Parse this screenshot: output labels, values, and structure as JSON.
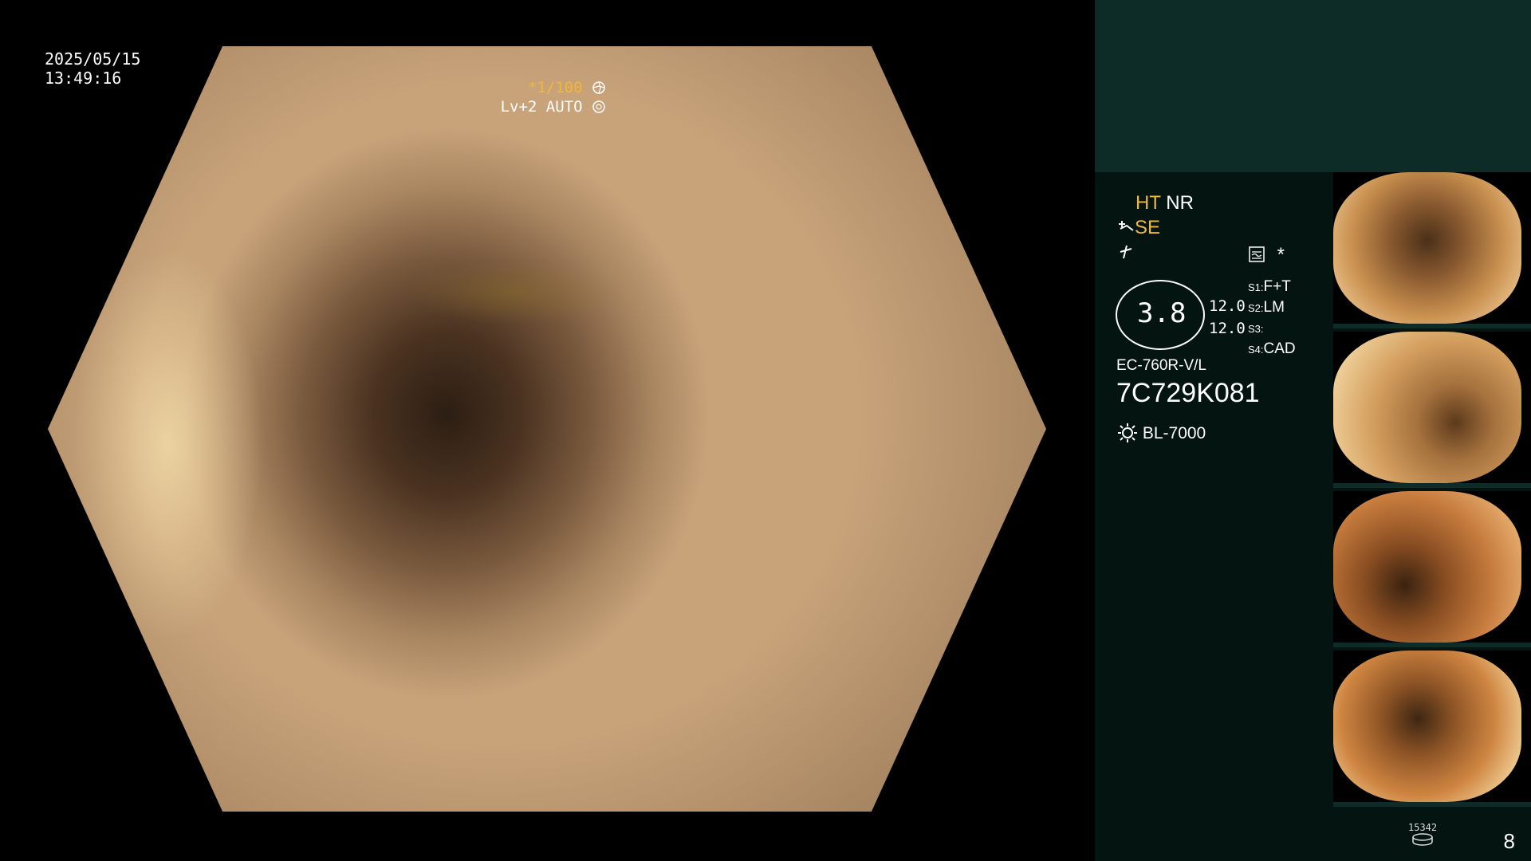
{
  "header": {
    "date": "2025/05/15",
    "time": "13:49:16",
    "shutter_prefix": "*",
    "shutter": "1/100",
    "level": "Lv+2 AUTO"
  },
  "panel": {
    "ht": "HT",
    "nr": "NR",
    "se": "SE",
    "ring_value": "3.8",
    "val1": "12.0",
    "val2": "12.0",
    "s1": "S1:",
    "s1_value": "F+T",
    "s2": "S2:",
    "s2_value": "LM",
    "s3": "S3:",
    "s3_value": "",
    "s4": "S4:",
    "s4_value": "CAD",
    "scope_model": "EC-760R-V/L",
    "serial": "7C729K081",
    "light": "BL-7000",
    "star": "*",
    "storage_label": "15342",
    "counter": "8"
  },
  "icons": {
    "shutter": "aperture-icon",
    "auto": "iris-icon",
    "enhance": "enhance-icon",
    "sharpness": "sharpness-icon",
    "monitor": "monitor-icon",
    "light": "sun-icon",
    "storage": "disk-icon"
  },
  "colors": {
    "accent": "#f2b735",
    "panel_bg": "#041410",
    "panel_top": "#0d2b27"
  }
}
